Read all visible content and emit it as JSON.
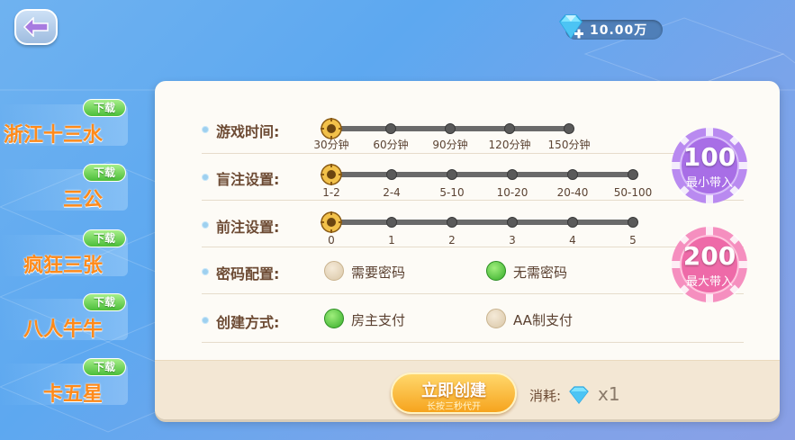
{
  "header": {
    "back_icon": "back-arrow-icon",
    "diamond_balance": "10.00万",
    "diamond_icon": "diamond-plus-icon"
  },
  "sidebar": {
    "items": [
      {
        "name": "浙江十三水",
        "badge": "下载"
      },
      {
        "name": "三公",
        "badge": "下载"
      },
      {
        "name": "疯狂三张",
        "badge": "下载"
      },
      {
        "name": "八人牛牛",
        "badge": "下载"
      },
      {
        "name": "卡五星",
        "badge": "下载"
      }
    ]
  },
  "settings": {
    "game_time": {
      "label": "游戏时间:",
      "options": [
        "30分钟",
        "60分钟",
        "90分钟",
        "120分钟",
        "150分钟"
      ],
      "selected_index": 0
    },
    "blind_bet": {
      "label": "盲注设置:",
      "options": [
        "1-2",
        "2-4",
        "5-10",
        "10-20",
        "20-40",
        "50-100"
      ],
      "selected_index": 0
    },
    "ante": {
      "label": "前注设置:",
      "options": [
        "0",
        "1",
        "2",
        "3",
        "4",
        "5"
      ],
      "selected_index": 0
    },
    "password": {
      "label": "密码配置:",
      "options": [
        "需要密码",
        "无需密码"
      ],
      "selected_index": 1
    },
    "create_mode": {
      "label": "创建方式:",
      "options": [
        "房主支付",
        "AA制支付"
      ],
      "selected_index": 0
    }
  },
  "chips": {
    "min": {
      "value": "100",
      "caption": "最小带入",
      "color": "#a86ee6"
    },
    "max": {
      "value": "200",
      "caption": "最大带入",
      "color": "#ee6aa8"
    }
  },
  "footer": {
    "create_label": "立即创建",
    "create_sub": "长按三秒代开",
    "cost_label": "消耗:",
    "cost_multiplier": "x1"
  }
}
